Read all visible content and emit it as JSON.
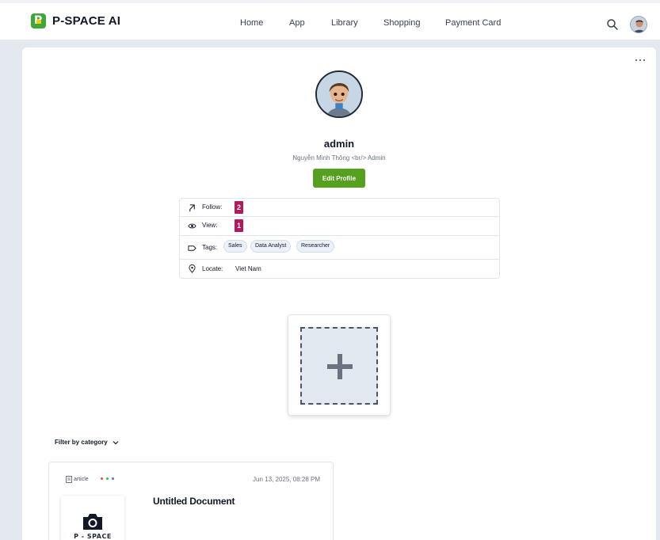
{
  "app": {
    "brand_name": "P-SPACE AI",
    "brand_letter": "P"
  },
  "nav": {
    "items": [
      "Home",
      "App",
      "Library",
      "Shopping",
      "Payment Card"
    ]
  },
  "profile": {
    "username": "admin",
    "subtitle": "Nguyễn Minh Thông <br/> Admin",
    "edit_label": "Edit Profile"
  },
  "info": {
    "follow_label": "Follow:",
    "follow_count": "2",
    "view_label": "View:",
    "view_count": "1",
    "tags_label": "Tags:",
    "tags": [
      "Sales",
      "Data Analyst",
      "Researcher"
    ],
    "locate_label": "Locate:",
    "locate_value": "Viet Nam"
  },
  "filter": {
    "label": "Filter by category"
  },
  "document": {
    "type": "article",
    "date": "Jun 13, 2025, 08:28 PM",
    "title": "Untitled Document",
    "thumb_label": "P - SPACE",
    "dot_colors": [
      "#ef4444",
      "#22c55e",
      "#6366f1"
    ]
  },
  "colors": {
    "accent_green": "#56a01f",
    "badge": "#b4185c",
    "brand_green": "#3ea63a"
  }
}
